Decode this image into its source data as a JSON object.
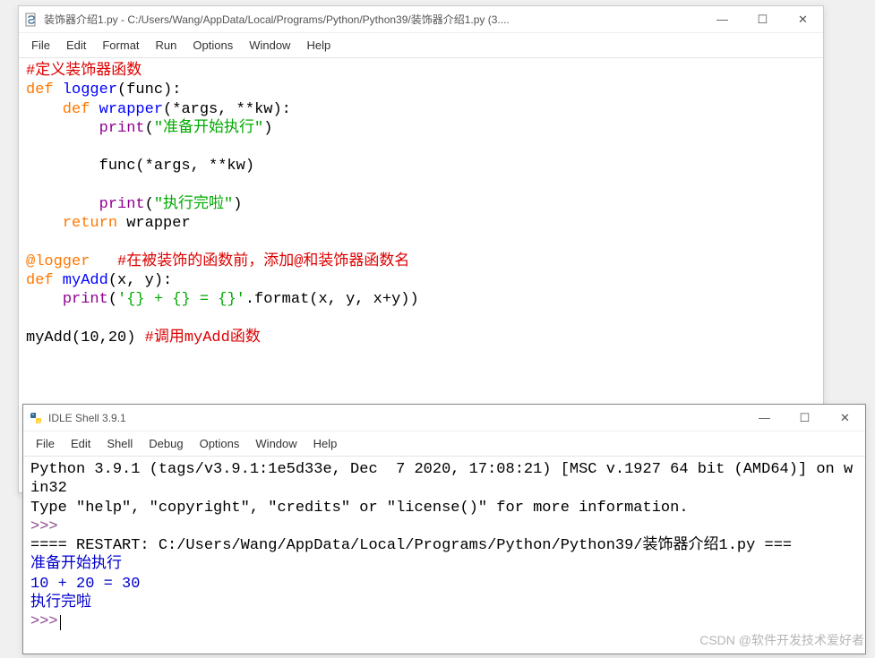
{
  "editor": {
    "title": "装饰器介绍1.py - C:/Users/Wang/AppData/Local/Programs/Python/Python39/装饰器介绍1.py (3....",
    "menus": [
      "File",
      "Edit",
      "Format",
      "Run",
      "Options",
      "Window",
      "Help"
    ],
    "code": {
      "l1_comment": "#定义装饰器函数",
      "l2_def": "def",
      "l2_name": " logger",
      "l2_rest": "(func):",
      "l3_def": "    def",
      "l3_name": " wrapper",
      "l3_rest": "(*args, **kw):",
      "l4_pre": "        ",
      "l4_print": "print",
      "l4_parenO": "(",
      "l4_str": "\"准备开始执行\"",
      "l4_parenC": ")",
      "l6": "        func(*args, **kw)",
      "l8_pre": "        ",
      "l8_print": "print",
      "l8_parenO": "(",
      "l8_str": "\"执行完啦\"",
      "l8_parenC": ")",
      "l9_pre": "    ",
      "l9_ret": "return",
      "l9_val": " wrapper",
      "l11_dec": "@logger   ",
      "l11_comment": "#在被装饰的函数前，添加@和装饰器函数名",
      "l12_def": "def",
      "l12_name": " myAdd",
      "l12_rest": "(x, y):",
      "l13_pre": "    ",
      "l13_print": "print",
      "l13_parenO": "(",
      "l13_str": "'{} + {} = {}'",
      "l13_rest": ".format(x, y, x+y))",
      "l15_call": "myAdd(10,20) ",
      "l15_comment": "#调用myAdd函数"
    }
  },
  "shell": {
    "title": "IDLE Shell 3.9.1",
    "menus": [
      "File",
      "Edit",
      "Shell",
      "Debug",
      "Options",
      "Window",
      "Help"
    ],
    "banner1": "Python 3.9.1 (tags/v3.9.1:1e5d33e, Dec  7 2020, 17:08:21) [MSC v.1927 64 bit (AMD64)] on win32",
    "banner2": "Type \"help\", \"copyright\", \"credits\" or \"license()\" for more information.",
    "prompt": ">>>",
    "restart": "==== RESTART: C:/Users/Wang/AppData/Local/Programs/Python/Python39/装饰器介绍1.py ===",
    "out1": "准备开始执行",
    "out2": "10 + 20 = 30",
    "out3": "执行完啦"
  },
  "controls": {
    "min": "—",
    "max": "☐",
    "close": "✕"
  },
  "watermark": "CSDN @软件开发技术爱好者"
}
